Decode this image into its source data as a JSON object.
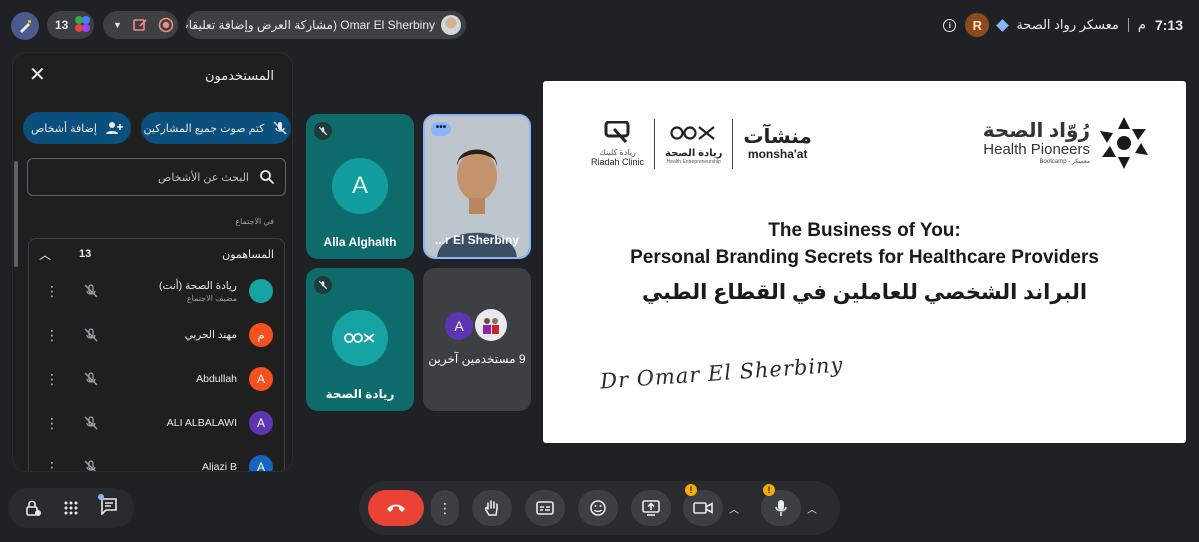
{
  "topbar": {
    "participant_count": "13",
    "presenter_label": "Omar El Sherbiny (مشاركة العرض وإضافة تعليقات توضيحية)",
    "clock": "7:13",
    "clock_suffix": "م",
    "meeting_title": "معسكر رواد الصحة",
    "host_initial": "R"
  },
  "panel": {
    "title": "المستخدمون",
    "add_people": "إضافة أشخاص",
    "mute_all": "كتم صوت جميع المشاركين",
    "search_placeholder": "البحث عن الأشخاص",
    "section_label": "في الاجتماع",
    "contributors_label": "المساهمون",
    "contributors_count": "13",
    "participants": [
      {
        "name": "ريادة الصحة (أنت)",
        "sub": "مضيف الاجتماع",
        "initial": "",
        "color": "#15a3a3"
      },
      {
        "name": "مهند الحربي",
        "sub": "",
        "initial": "م",
        "color": "#f4511e"
      },
      {
        "name": "Abdullah",
        "sub": "",
        "initial": "A",
        "color": "#f4511e"
      },
      {
        "name": "ALI ALBALAWI",
        "sub": "",
        "initial": "A",
        "color": "#5e35b1"
      },
      {
        "name": "Aljazi B",
        "sub": "",
        "initial": "A",
        "color": "#1565c0"
      }
    ]
  },
  "tiles": {
    "alla": {
      "name": "Alla Alghalth",
      "initial": "A"
    },
    "omar": {
      "name": "...r El Sherbiny"
    },
    "riyada": {
      "name": "ريادة الصحة"
    },
    "others": {
      "name": "9 مستخدمين آخرين",
      "initial": "A"
    }
  },
  "slide": {
    "title_line1": "The Business of You:",
    "title_line2": "Personal Branding Secrets for Healthcare Providers",
    "title_line3": "البراند الشخصي للعاملين في القطاع الطبي",
    "signature": "Dr Omar El Sherbiny",
    "hp_arabic": "رُوّاد الصحة",
    "hp_english": "Health Pioneers",
    "hp_sub": "Bootcamp - معسكر",
    "partner_riadah": "Riadah Clinic",
    "partner_riadah_ar": "ريادة كلينك",
    "partner_riyada_ar": "ريادة الصحة",
    "partner_riyada_en": "Health Entrepreneurship",
    "partner_monshaat_ar": "منشآت",
    "partner_monshaat_en": "monsha'at"
  },
  "colors": {
    "end_call": "#ea4335",
    "accent_blue": "#0b4f7d",
    "tile_teal": "#0e6b6b",
    "warning": "#f9ab00"
  }
}
